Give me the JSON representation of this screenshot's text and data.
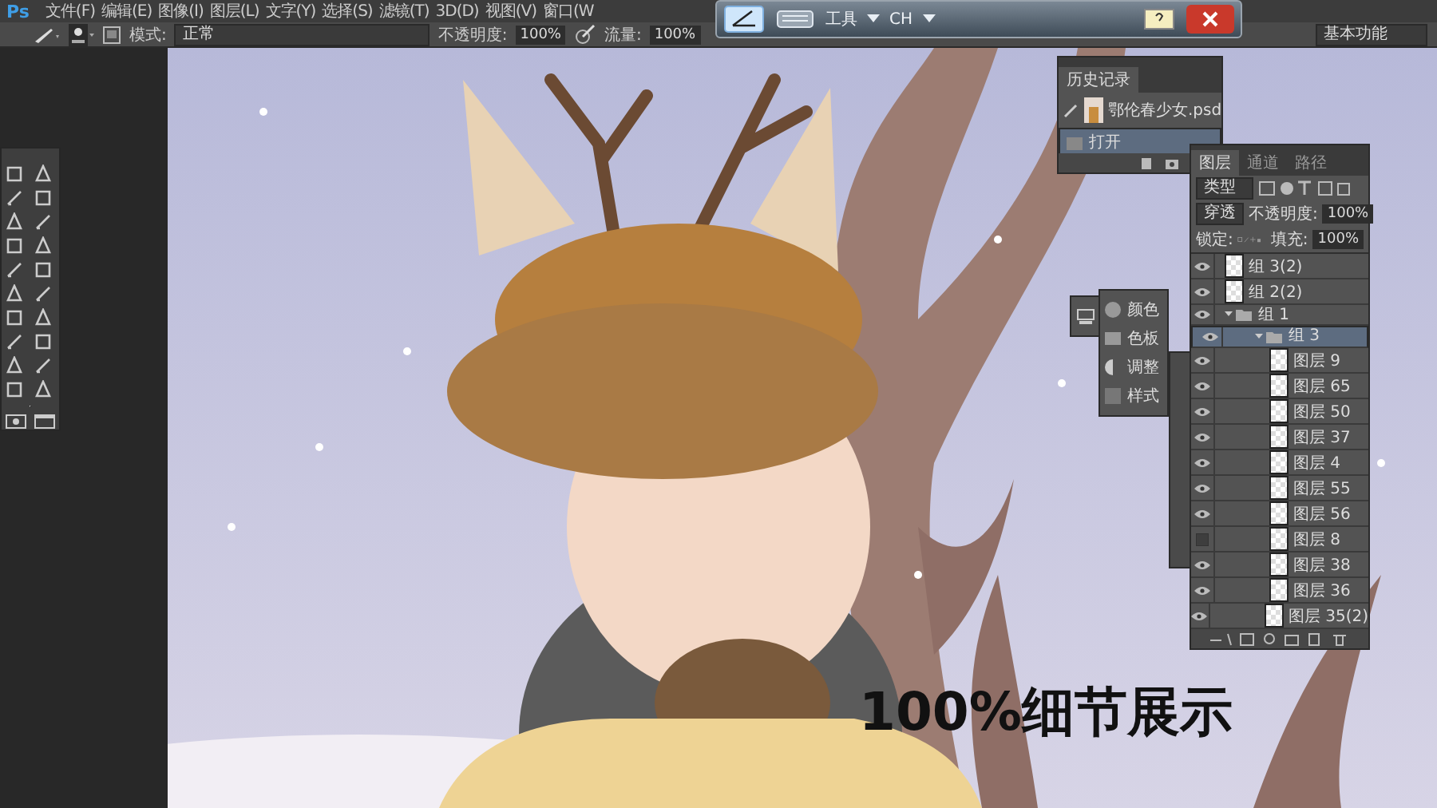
{
  "menu_bar": {
    "logo": "Ps",
    "items": [
      "文件(F)",
      "编辑(E)",
      "图像(I)",
      "图层(L)",
      "文字(Y)",
      "选择(S)",
      "滤镜(T)",
      "3D(D)",
      "视图(V)",
      "窗口(W"
    ]
  },
  "options_bar": {
    "mode_label": "模式:",
    "mode": "正常",
    "opacity_label": "不透明度:",
    "opacity": "100%",
    "flow_label": "流量:",
    "flow": "100%",
    "workspace": "基本功能"
  },
  "ime_toolbar": {
    "menu_label": "工具",
    "language": "CH"
  },
  "history_panel": {
    "tab": "历史记录",
    "snapshot": "鄂伦春少女.psd",
    "states": [
      {
        "label": "打开",
        "selected": true
      }
    ]
  },
  "adjust_panel": {
    "items": [
      {
        "label": "颜色",
        "kind": "color"
      },
      {
        "label": "色板",
        "kind": "swatches"
      },
      {
        "label": "调整",
        "kind": "adjust"
      },
      {
        "label": "样式",
        "kind": "styles"
      }
    ]
  },
  "layers_panel": {
    "tabs": [
      {
        "label": "图层",
        "selected": true
      },
      {
        "label": "通道",
        "selected": false
      },
      {
        "label": "路径",
        "selected": false
      }
    ],
    "filter": "类型",
    "blend_mode": "穿透",
    "opacity_label": "不透明度:",
    "opacity": "100%",
    "lock_label": "锁定:",
    "fill_label": "填充:",
    "fill": "100%",
    "layers": [
      {
        "name": "组 3(2)",
        "kind": "layer",
        "visible": true,
        "selected": false
      },
      {
        "name": "组 2(2)",
        "kind": "layer",
        "visible": true,
        "selected": false
      },
      {
        "name": "组 1",
        "kind": "group",
        "visible": true,
        "selected": false,
        "expanded": true,
        "children": [
          {
            "name": "组 3",
            "kind": "group",
            "visible": true,
            "selected": true,
            "expanded": true,
            "children": [
              {
                "name": "图层 9",
                "kind": "layer",
                "visible": true,
                "selected": false
              },
              {
                "name": "图层 65",
                "kind": "layer",
                "visible": true,
                "selected": false
              },
              {
                "name": "图层 50",
                "kind": "layer",
                "visible": true,
                "selected": false
              },
              {
                "name": "图层 37",
                "kind": "layer",
                "visible": true,
                "selected": false
              },
              {
                "name": "图层 4",
                "kind": "layer",
                "visible": true,
                "selected": false
              },
              {
                "name": "图层 55",
                "kind": "layer",
                "visible": true,
                "selected": false
              },
              {
                "name": "图层 56",
                "kind": "layer",
                "visible": true,
                "selected": false
              },
              {
                "name": "图层 8",
                "kind": "layer",
                "visible": false,
                "selected": false
              },
              {
                "name": "图层 38",
                "kind": "layer",
                "visible": true,
                "selected": false
              },
              {
                "name": "图层 36",
                "kind": "layer",
                "visible": true,
                "selected": false
              },
              {
                "name": "图层 35(2)",
                "kind": "layer",
                "visible": true,
                "selected": false
              }
            ]
          }
        ]
      }
    ]
  },
  "caption": "100%细节展示"
}
